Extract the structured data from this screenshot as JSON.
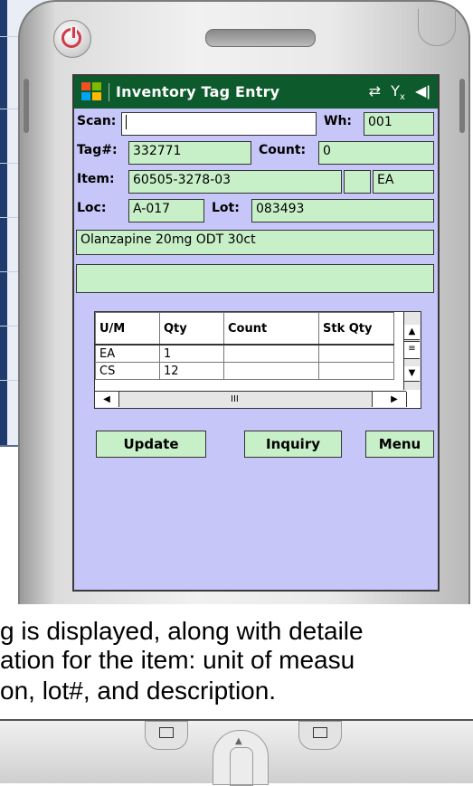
{
  "device": {
    "title_bar": {
      "app_title": "Inventory Tag Entry",
      "icons": [
        "windows-flag-icon",
        "sync-icon",
        "signal-off-icon",
        "speaker-icon"
      ]
    },
    "form": {
      "scan": {
        "label": "Scan:",
        "value": ""
      },
      "wh": {
        "label": "Wh:",
        "value": "001"
      },
      "tag": {
        "label": "Tag#:",
        "value": "332771"
      },
      "count": {
        "label": "Count:",
        "value": "0"
      },
      "item": {
        "label": "Item:",
        "value": "60505-3278-03",
        "uom": "EA"
      },
      "loc": {
        "label": "Loc:",
        "value": "A-017"
      },
      "lot": {
        "label": "Lot:",
        "value": "083493"
      },
      "description": "Olanzapine 20mg ODT 30ct",
      "description2": ""
    },
    "grid": {
      "columns": [
        "U/M",
        "Qty",
        "Count",
        "Stk Qty"
      ],
      "rows": [
        {
          "um": "EA",
          "qty": "1",
          "count": "",
          "stk": ""
        },
        {
          "um": "CS",
          "qty": "12",
          "count": "",
          "stk": ""
        }
      ],
      "scroll_mid": "III"
    },
    "buttons": {
      "update": "Update",
      "inquiry": "Inquiry",
      "menu": "Menu"
    }
  },
  "caption": {
    "line1": "g is displayed, along with detaile",
    "line2": "ation for the item: unit of measu",
    "line3": "on, lot#, and description."
  },
  "colors": {
    "titlebar": "#0d5a2c",
    "screen_bg": "#c6c6f8",
    "field_bg": "#c8f0c8"
  }
}
